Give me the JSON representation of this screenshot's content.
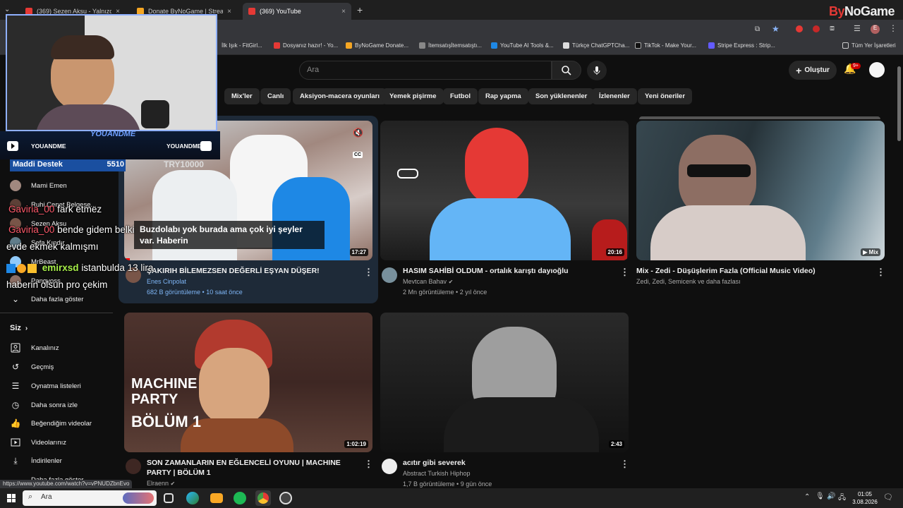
{
  "browser": {
    "tabs": [
      {
        "title": "(369) Sezen Aksu - Yalnızca...",
        "active": false
      },
      {
        "title": "Donate ByNoGame | Streamer...",
        "active": false
      },
      {
        "title": "(369) YouTube",
        "active": true
      }
    ],
    "new_tab": "+",
    "bookmarks": [
      "İlk Işık - FitGirl...",
      "Dosyanız hazır! - Yo...",
      "ByNoGame Donate...",
      "İtemsatışİtemsatıştı...",
      "YouTube AI Tools &...",
      "Türkçe ChatGPTCha...",
      "TikTok - Make Your...",
      "Stripe Express : Strip..."
    ],
    "all_bookmarks": "Tüm Yer İşaretleri",
    "brand": {
      "prefix": "By",
      "name": "NoGame"
    },
    "status_url": "https://www.youtube.com/watch?v=vPNUDZbnEvo"
  },
  "header": {
    "search_placeholder": "Ara",
    "create_label": "Oluştur",
    "notifications_badge": "9+"
  },
  "chips": [
    "Mix'ler",
    "Canlı",
    "Aksiyon-macera oyunları",
    "Yemek pişirme",
    "Futbol",
    "Rap yapma",
    "Son yüklenenler",
    "İzlenenler",
    "Yeni öneriler"
  ],
  "sidebar": {
    "subscriptions": [
      {
        "name": "Mami Emen"
      },
      {
        "name": "Ruhi Çenet Belgese..."
      },
      {
        "name": "Sezen Aksu"
      },
      {
        "name": "Sefa Kındır"
      },
      {
        "name": "MrBeast"
      },
      {
        "name": "Pangvoss"
      }
    ],
    "show_more": "Daha fazla göster",
    "you_label": "Siz",
    "you_items": [
      {
        "label": "Kanalınız",
        "icon": "channel-icon"
      },
      {
        "label": "Geçmiş",
        "icon": "history-icon"
      },
      {
        "label": "Oynatma listeleri",
        "icon": "playlist-icon"
      },
      {
        "label": "Daha sonra izle",
        "icon": "watch-later-icon"
      },
      {
        "label": "Beğendiğim videolar",
        "icon": "like-icon"
      },
      {
        "label": "Videolarınız",
        "icon": "videos-icon"
      },
      {
        "label": "İndirilenler",
        "icon": "download-icon"
      },
      {
        "label": "Daha fazla göster",
        "icon": "chevron-down-icon"
      }
    ]
  },
  "videos": [
    {
      "title": "ŞAKIRIH BİLEMEZSEN DEĞERLİ EŞYAN DÜŞER!",
      "channel": "Enes Cinpolat",
      "meta": "682 B görüntüleme • 10 saat önce",
      "duration": "17:27",
      "caption": "Buzdolabı yok burada ama çok iyi şeyler var. Haberin",
      "cc": "CC"
    },
    {
      "title": "HASIM SAHİBİ OLDUM - ortalık karıştı dayıoğlu",
      "channel": "Mevtcan Bahav",
      "meta": "2 Mn görüntüleme • 2 yıl önce",
      "duration": "20:16"
    },
    {
      "title": "Mix - Zedi - Düşüşlerim Fazla (Official Music Video)",
      "channel": "Zedi, Zedi, Semicenk ve daha fazlası",
      "meta": "",
      "duration": "Mix"
    },
    {
      "title": "SON ZAMANLARIN EN EĞLENCELİ OYUNU | MACHINE PARTY | BÖLÜM 1",
      "channel": "Elraenn",
      "meta": "",
      "duration": "1:02:19",
      "thumb_text": [
        "MACHINE",
        "PARTY",
        "BÖLÜM 1"
      ]
    },
    {
      "title": "acıtır gibi severek",
      "channel": "Abstract Turkish Hiphop",
      "meta": "1,7 B görüntüleme • 9 gün önce",
      "duration": "2:43"
    }
  ],
  "overlay": {
    "cam_label": "YOUANDME",
    "youtube_handle": "YOUANDME",
    "twitch_handle": "YOUANDME",
    "donate_label": "Maddi Destek",
    "donate_value": "5510",
    "donate_target": "TRY10000",
    "chat": [
      {
        "user": "Gaviria_00",
        "msg": "fark etmez"
      },
      {
        "user": "Gaviria_00",
        "msg": "bende gidem belki"
      },
      {
        "user": "",
        "msg": "evde ekmek kalmışmı"
      },
      {
        "user": "emirxsd",
        "msg": "istanbulda 13 lira"
      },
      {
        "user": "",
        "msg": "haberin olsun pro çekim"
      }
    ]
  },
  "taskbar": {
    "search_label": "Ara",
    "time": "01:05",
    "date": "3.08.2026"
  }
}
